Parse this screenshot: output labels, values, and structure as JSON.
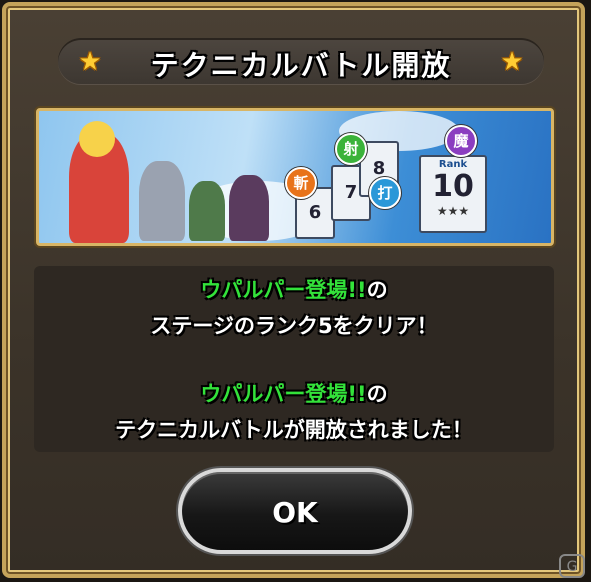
{
  "dialog": {
    "title": "テクニカルバトル開放",
    "message": {
      "line1_highlight": "ウパルパー登場!!",
      "line1_suffix": "の",
      "line2": "ステージのランク5をクリア！",
      "line3_highlight": "ウパルパー登場!!",
      "line3_suffix": "の",
      "line4": "テクニカルバトルが開放されました！"
    },
    "ok_label": "OK"
  },
  "banner": {
    "badges": [
      "斬",
      "射",
      "打",
      "魔"
    ],
    "card_rank_label": "Rank",
    "card_values": [
      "6",
      "7",
      "8",
      "10"
    ]
  },
  "watermark": "G",
  "colors": {
    "frame_gold": "#c4a35a",
    "highlight_green": "#33e23a",
    "panel_brown": "#3b3329"
  }
}
